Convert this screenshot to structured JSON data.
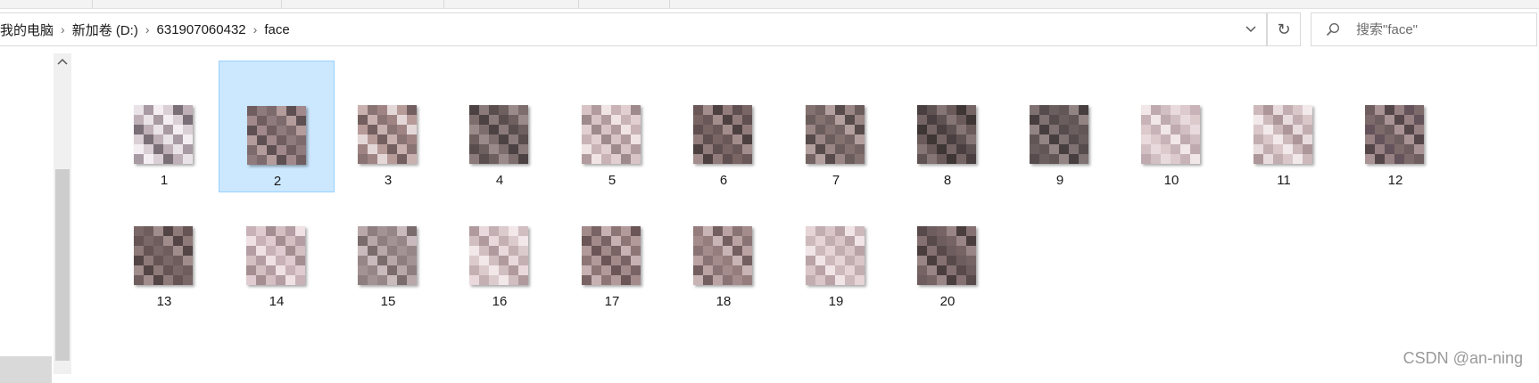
{
  "breadcrumb": [
    "我的电脑",
    "新加卷 (D:)",
    "631907060432",
    "face"
  ],
  "search": {
    "placeholder": "搜索\"face\""
  },
  "files": [
    {
      "name": "1",
      "selected": false,
      "palette": [
        "#e9e3e8",
        "#bfb0b8",
        "#7a6f76",
        "#d9cfd4",
        "#f4eef2",
        "#a89aa2"
      ]
    },
    {
      "name": "2",
      "selected": true,
      "palette": [
        "#8f7a7d",
        "#6f5d60",
        "#a1898b",
        "#5e5052",
        "#b39c9b",
        "#7d6a6c"
      ]
    },
    {
      "name": "3",
      "selected": false,
      "palette": [
        "#a08484",
        "#8a7373",
        "#c9b1b0",
        "#735f60",
        "#b69b99",
        "#e4d7d8"
      ]
    },
    {
      "name": "4",
      "selected": false,
      "palette": [
        "#6f6060",
        "#5a4d4e",
        "#8a7a7a",
        "#4c4243",
        "#7d6e6d",
        "#9a8b8a"
      ]
    },
    {
      "name": "5",
      "selected": false,
      "palette": [
        "#e2cfd1",
        "#c9b3b6",
        "#f0e4e5",
        "#b29b9e",
        "#d8c4c6",
        "#9e8a8c"
      ]
    },
    {
      "name": "6",
      "selected": false,
      "palette": [
        "#7a6565",
        "#5f4f50",
        "#927c7b",
        "#4d4041",
        "#a38d8c",
        "#6a5859"
      ]
    },
    {
      "name": "7",
      "selected": false,
      "palette": [
        "#847271",
        "#6c5d5d",
        "#9a8685",
        "#574b4b",
        "#b3a09e",
        "#746464"
      ]
    },
    {
      "name": "8",
      "selected": false,
      "palette": [
        "#5f5252",
        "#4a3f40",
        "#746564",
        "#3e3535",
        "#6a5a5a",
        "#857575"
      ]
    },
    {
      "name": "9",
      "selected": false,
      "palette": [
        "#6b5e5e",
        "#574c4d",
        "#807272",
        "#473e3f",
        "#938484",
        "#625656"
      ]
    },
    {
      "name": "10",
      "selected": false,
      "palette": [
        "#e8dadd",
        "#d1bfc3",
        "#bfaab0",
        "#f1e6e8",
        "#c8b3b8",
        "#dccacd"
      ]
    },
    {
      "name": "11",
      "selected": false,
      "palette": [
        "#d9c7ca",
        "#c2adb1",
        "#e9dcdf",
        "#ad969a",
        "#cdb9bc",
        "#f2e9eb"
      ]
    },
    {
      "name": "12",
      "selected": false,
      "palette": [
        "#7d6a6b",
        "#64535a",
        "#978183",
        "#55464a",
        "#a99395",
        "#6f5e60"
      ]
    },
    {
      "name": "13",
      "selected": false,
      "palette": [
        "#7a6767",
        "#665454",
        "#8e7a79",
        "#534445",
        "#a08c8b",
        "#6f5d5e"
      ]
    },
    {
      "name": "14",
      "selected": false,
      "palette": [
        "#e0ccd0",
        "#c8b2b7",
        "#efe1e4",
        "#b49ea3",
        "#d4bfc3",
        "#a48e92"
      ]
    },
    {
      "name": "15",
      "selected": false,
      "palette": [
        "#a39395",
        "#8e7e80",
        "#b8a8aa",
        "#7a6b6d",
        "#c9bbbd",
        "#968687"
      ]
    },
    {
      "name": "16",
      "selected": false,
      "palette": [
        "#dccbcd",
        "#c4b0b3",
        "#ead9dc",
        "#b09a9d",
        "#d1bec1",
        "#f2e7e9"
      ]
    },
    {
      "name": "17",
      "selected": false,
      "palette": [
        "#b29a9b",
        "#8d7576",
        "#c8b1b2",
        "#7a6364",
        "#a38a8b",
        "#6b5556"
      ]
    },
    {
      "name": "18",
      "selected": false,
      "palette": [
        "#a48c8d",
        "#8a7374",
        "#bba3a4",
        "#745f60",
        "#c9b4b5",
        "#957d7e"
      ]
    },
    {
      "name": "19",
      "selected": false,
      "palette": [
        "#e6d4d7",
        "#cdb9bc",
        "#f1e5e7",
        "#b9a3a7",
        "#dac6c9",
        "#c2adb0"
      ]
    },
    {
      "name": "20",
      "selected": false,
      "palette": [
        "#6e5d5e",
        "#584a4b",
        "#857172",
        "#4a3d3e",
        "#9a8586",
        "#766364"
      ]
    }
  ],
  "watermark": "CSDN @an-ning"
}
